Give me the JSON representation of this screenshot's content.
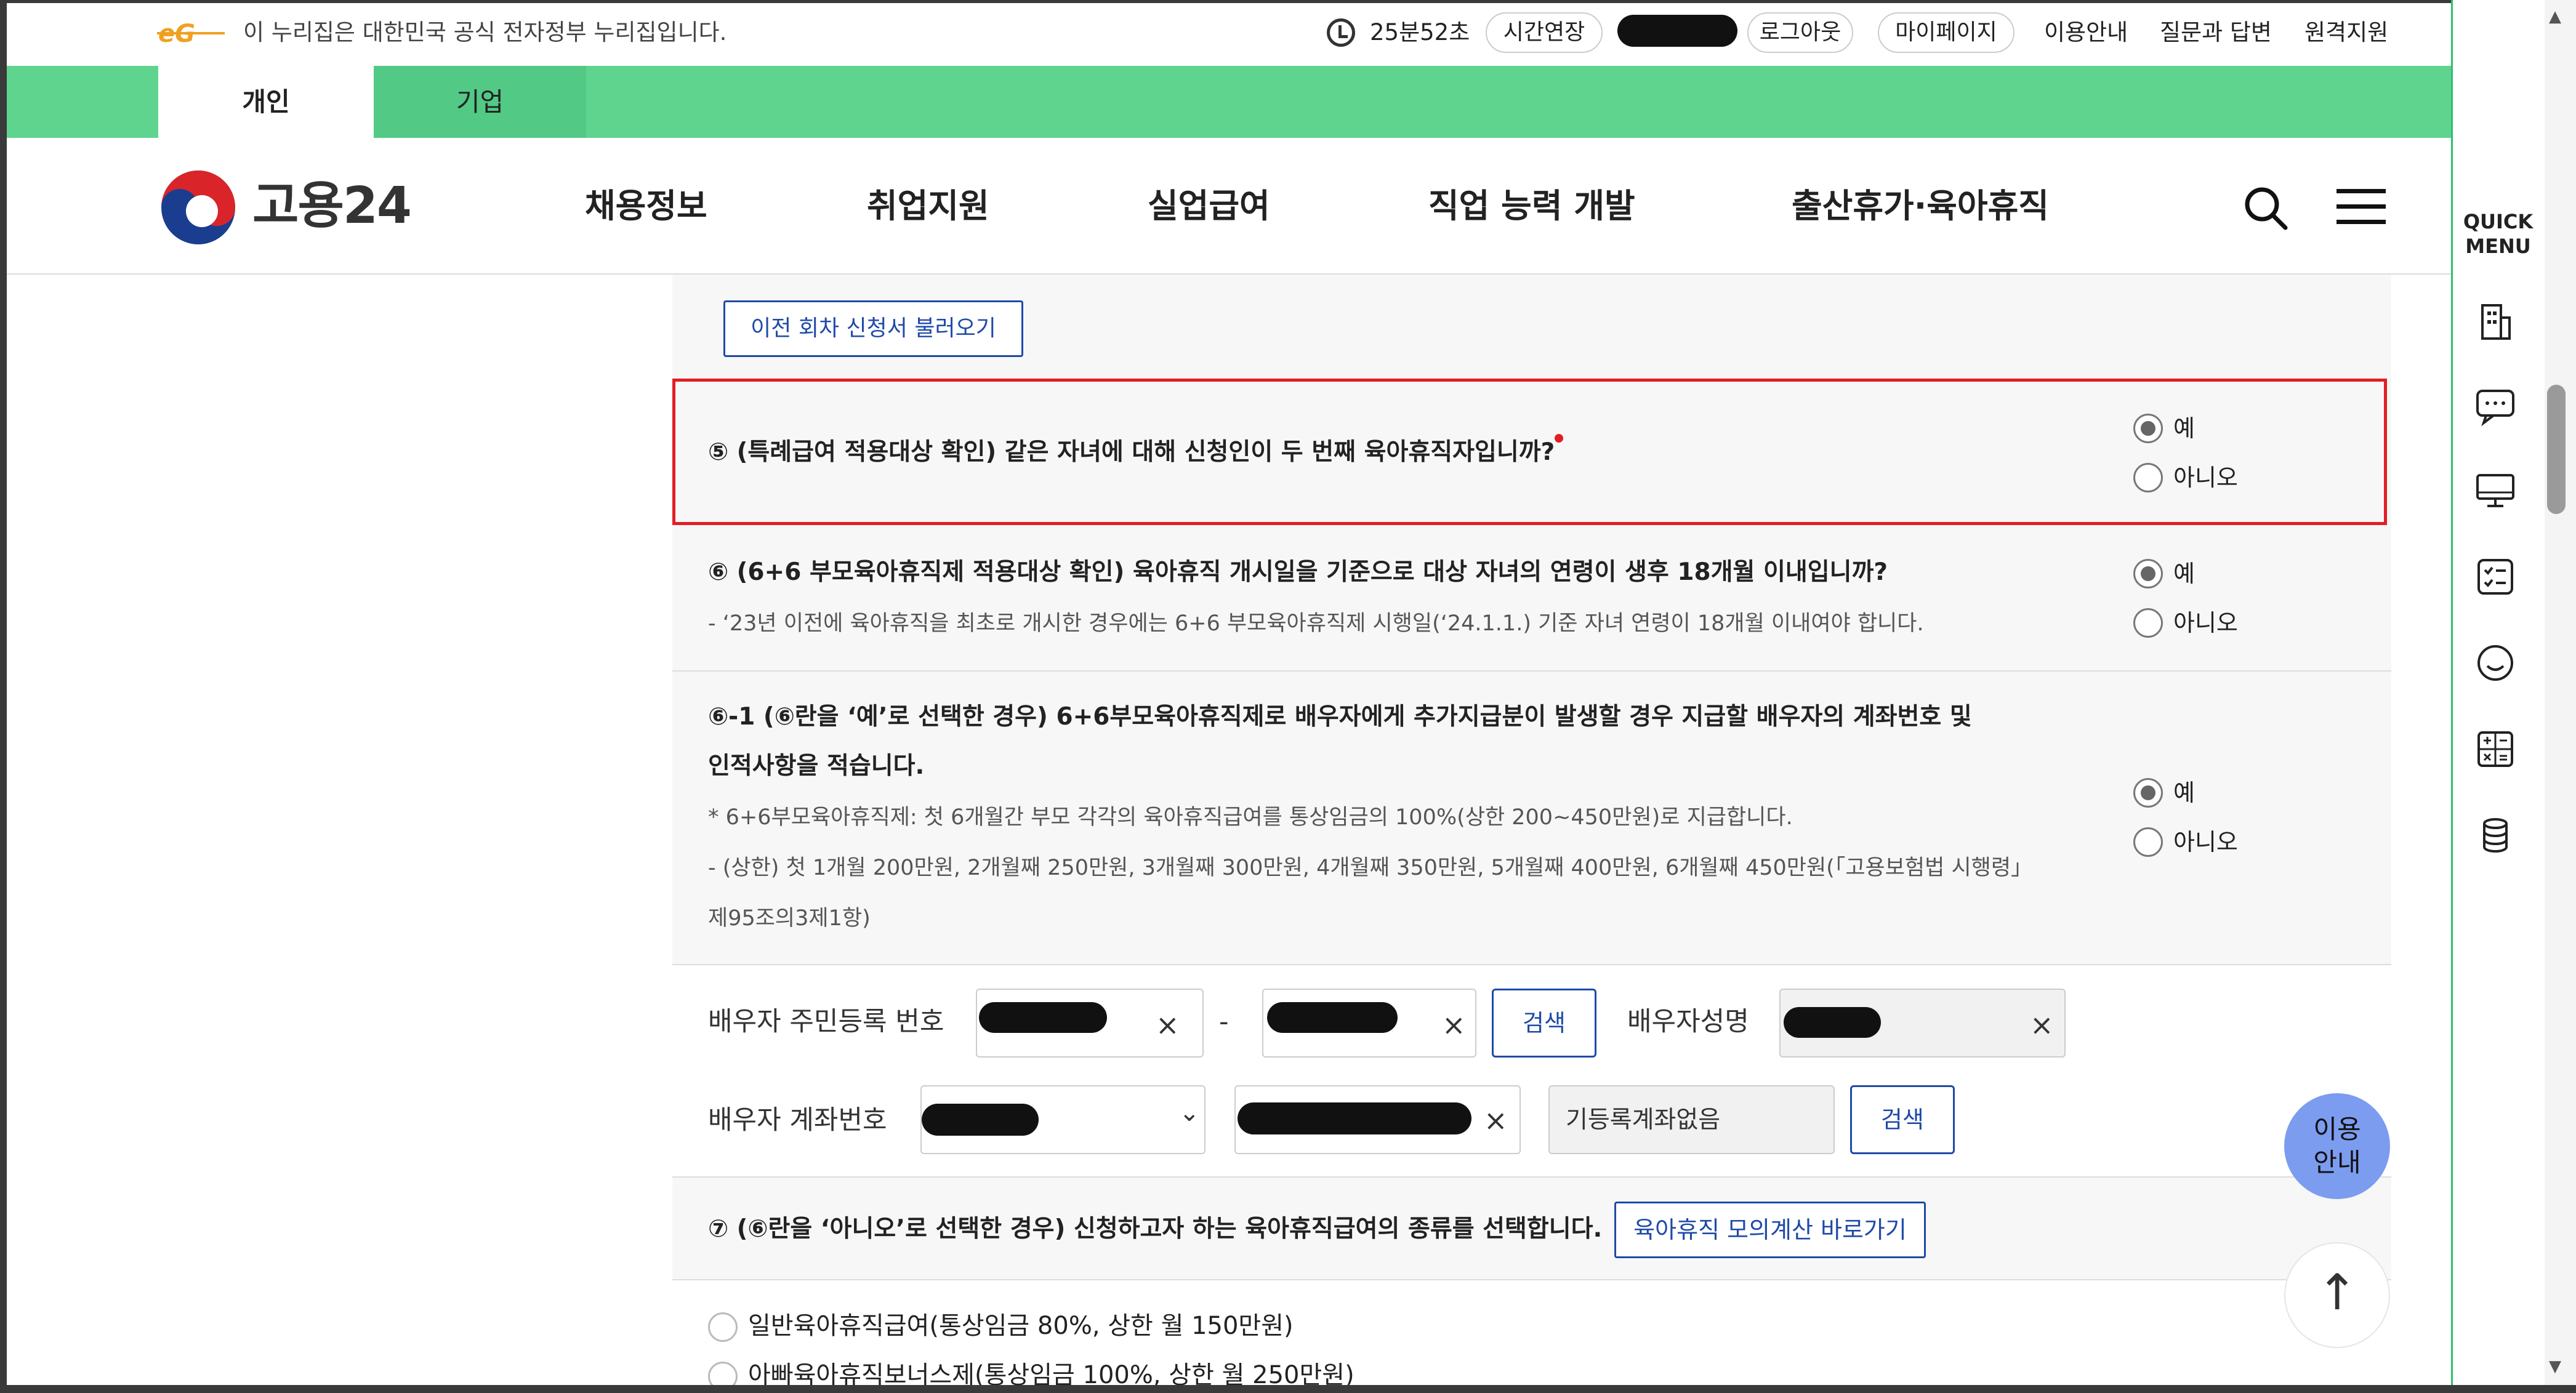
{
  "gov_bar": {
    "text": "이 누리집은 대한민국 공식 전자정부 누리집입니다.",
    "timer": "25분52초",
    "extend_label": "시간연장",
    "logout_label": "로그아웃",
    "mypage_label": "마이페이지",
    "links": [
      "이용안내",
      "질문과 답변",
      "원격지원"
    ]
  },
  "tabs": [
    "개인",
    "기업"
  ],
  "brand": {
    "name": "고용24"
  },
  "nav": [
    "채용정보",
    "취업지원",
    "실업급여",
    "직업 능력 개발",
    "출산휴가·육아휴직"
  ],
  "quick_menu": {
    "title_line1": "QUICK",
    "title_line2": "MENU",
    "icons": [
      "building-icon",
      "chat-icon",
      "monitor-icon",
      "checklist-icon",
      "smile-icon",
      "calculator-icon",
      "coins-icon"
    ]
  },
  "form": {
    "prev_button": "이전 회차 신청서 불러오기",
    "q5": {
      "text": "⑤ (특례급여 적용대상 확인) 같은 자녀에 대해 신청인이 두 번째 육아휴직자입니까?",
      "yes": "예",
      "no": "아니오",
      "selected": "예"
    },
    "q6": {
      "text": "⑥ (6+6 부모육아휴직제 적용대상 확인) 육아휴직 개시일을 기준으로 대상 자녀의 연령이 생후 18개월 이내입니까?",
      "note": "- ‘23년 이전에 육아휴직을 최초로 개시한 경우에는 6+6 부모육아휴직제 시행일(‘24.1.1.) 기준 자녀 연령이 18개월 이내여야 합니다.",
      "yes": "예",
      "no": "아니오",
      "selected": "예"
    },
    "q6_1": {
      "text_line1": "⑥-1 (⑥란을 ‘예’로 선택한 경우) 6+6부모육아휴직제로 배우자에게 추가지급분이 발생할 경우 지급할 배우자의 계좌번호 및",
      "text_line2": "인적사항을 적습니다.",
      "note1": "* 6+6부모육아휴직제: 첫 6개월간 부모 각각의 육아휴직급여를 통상임금의 100%(상한 200~450만원)로 지급합니다.",
      "note2": "- (상한) 첫 1개월 200만원, 2개월째 250만원, 3개월째 300만원, 4개월째 350만원, 5개월째 400만원, 6개월째 450만원(「고용보험법 시행령」",
      "note3": "제95조의3제1항)",
      "yes": "예",
      "no": "아니오",
      "selected": "예"
    },
    "spouse": {
      "rrn_label": "배우자 주민등록 번호",
      "dash": "-",
      "search_label": "검색",
      "name_label": "배우자성명",
      "account_label": "배우자 계좌번호",
      "no_registered_account": "기등록계좌없음",
      "clear": "×",
      "chevron": "⌄"
    },
    "q7": {
      "text": "⑦ (⑥란을 ‘아니오’로 선택한 경우) 신청하고자 하는 육아휴직급여의 종류를 선택합니다.",
      "sim_button": "육아휴직 모의계산 바로가기",
      "options": [
        "일반육아휴직급여(통상임금 80%, 상한 월 150만원)",
        "아빠육아휴직보너스제(통상임금 100%, 상한 월 250만원)"
      ]
    }
  },
  "floating": {
    "guide_line1": "이용",
    "guide_line2": "안내",
    "top_arrow": "↑"
  }
}
